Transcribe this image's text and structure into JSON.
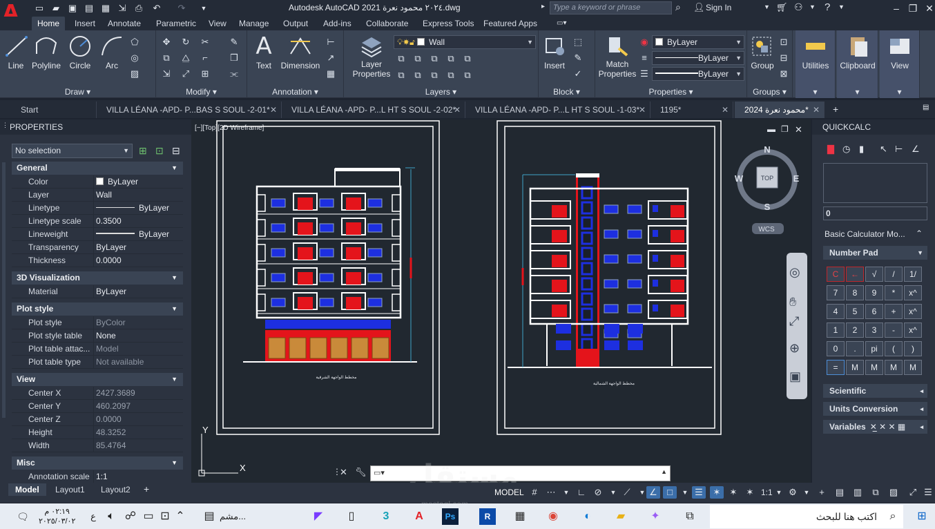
{
  "app": {
    "title": "Autodesk AutoCAD 2021  ٢٠٢٤ محمود نعرة.dwg",
    "search_placeholder": "Type a keyword or phrase",
    "sign_in": "Sign In",
    "logo_letter": "A"
  },
  "ribbon_tabs": [
    "Home",
    "Insert",
    "Annotate",
    "Parametric",
    "View",
    "Manage",
    "Output",
    "Add-ins",
    "Collaborate",
    "Express Tools",
    "Featured Apps"
  ],
  "ribbon": {
    "draw": {
      "title": "Draw",
      "line": "Line",
      "polyline": "Polyline",
      "circle": "Circle",
      "arc": "Arc"
    },
    "modify": {
      "title": "Modify"
    },
    "annotation": {
      "title": "Annotation",
      "text": "Text",
      "dimension": "Dimension"
    },
    "layers": {
      "title": "Layers",
      "layer_properties": "Layer Properties",
      "current_layer": "Wall"
    },
    "block": {
      "title": "Block",
      "insert": "Insert"
    },
    "properties": {
      "title": "Properties",
      "match": "Match Properties",
      "color": "ByLayer",
      "linetype": "ByLayer",
      "lineweight": "ByLayer"
    },
    "groups": {
      "title": "Groups",
      "group": "Group"
    },
    "utilities": "Utilities",
    "clipboard": "Clipboard",
    "view": "View"
  },
  "doc_tabs": [
    {
      "label": "Start",
      "active": false
    },
    {
      "label": "VILLA LÉANA -APD- P...BAS S SOUL -2-01*",
      "active": false
    },
    {
      "label": "VILLA LÉANA -APD- P...L HT S SOUL -2-02*",
      "active": false
    },
    {
      "label": "VILLA LÉANA -APD- P...L HT S SOUL -1-03*",
      "active": false
    },
    {
      "label": "1195*",
      "active": false
    },
    {
      "label": "محمود نعرة 2024*",
      "active": true
    }
  ],
  "properties": {
    "title": "PROPERTIES",
    "selection": "No selection",
    "sections": {
      "general": {
        "title": "General",
        "rows": [
          {
            "k": "Color",
            "v": "ByLayer"
          },
          {
            "k": "Layer",
            "v": "Wall"
          },
          {
            "k": "Linetype",
            "v": "ByLayer"
          },
          {
            "k": "Linetype scale",
            "v": "0.3500"
          },
          {
            "k": "Lineweight",
            "v": "ByLayer"
          },
          {
            "k": "Transparency",
            "v": "ByLayer"
          },
          {
            "k": "Thickness",
            "v": "0.0000"
          }
        ]
      },
      "viz": {
        "title": "3D Visualization",
        "rows": [
          {
            "k": "Material",
            "v": "ByLayer"
          }
        ]
      },
      "plot": {
        "title": "Plot style",
        "rows": [
          {
            "k": "Plot style",
            "v": "ByColor"
          },
          {
            "k": "Plot style table",
            "v": "None"
          },
          {
            "k": "Plot table attac...",
            "v": "Model"
          },
          {
            "k": "Plot table type",
            "v": "Not available"
          }
        ]
      },
      "view": {
        "title": "View",
        "rows": [
          {
            "k": "Center X",
            "v": "2427.3689"
          },
          {
            "k": "Center Y",
            "v": "460.2097"
          },
          {
            "k": "Center Z",
            "v": "0.0000"
          },
          {
            "k": "Height",
            "v": "48.3252"
          },
          {
            "k": "Width",
            "v": "85.4764"
          }
        ]
      },
      "misc": {
        "title": "Misc",
        "rows": [
          {
            "k": "Annotation scale",
            "v": "1:1"
          }
        ]
      }
    }
  },
  "viewport": {
    "label": "[−][Top][2D Wireframe]",
    "caption_left": "مخطط الواجهة الشرقية",
    "caption_right": "مخطط الواجهة الشمالية",
    "viewcube": {
      "n": "N",
      "s": "S",
      "e": "E",
      "w": "W",
      "top": "TOP",
      "wcs": "WCS"
    },
    "ucs_x": "X",
    "ucs_y": "Y"
  },
  "quickcalc": {
    "title": "QUICKCALC",
    "display": "0",
    "mode": "Basic Calculator Mo...",
    "number_pad": "Number Pad",
    "keys": [
      [
        "C",
        "←",
        "√",
        "/",
        "1/"
      ],
      [
        "7",
        "8",
        "9",
        "*",
        "x^"
      ],
      [
        "4",
        "5",
        "6",
        "+",
        "x^"
      ],
      [
        "1",
        "2",
        "3",
        "-",
        "x^"
      ],
      [
        "0",
        ".",
        "pi",
        "(",
        ")"
      ],
      [
        "=",
        "M",
        "M",
        "M",
        "M"
      ]
    ],
    "sections": [
      "Scientific",
      "Units Conversion",
      "Variables"
    ]
  },
  "layout_tabs": [
    "Model",
    "Layout1",
    "Layout2"
  ],
  "status": {
    "model": "MODEL",
    "scale": "1:1"
  },
  "taskbar": {
    "search_placeholder": "اكتب هنا للبحث",
    "time": "٠٢:١٩ م",
    "date": "٢٠٢٥/٠٣/٠٢",
    "lang": "ع",
    "pinned_label": "مشم..."
  },
  "watermark": {
    "big": "مستقل",
    "small": "mostaql.com"
  },
  "colors": {
    "accent": "#4e8ed8",
    "red": "#e32228",
    "panel": "#3a4454",
    "bg": "#212830"
  }
}
